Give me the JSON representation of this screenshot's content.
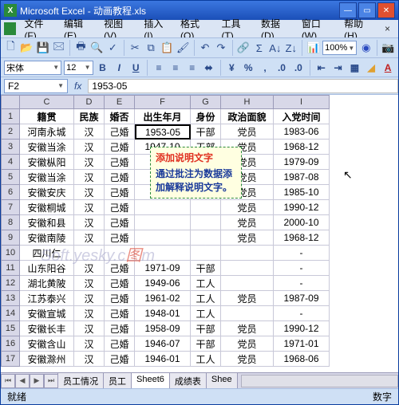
{
  "window": {
    "app": "Microsoft Excel",
    "doc": "动画教程.xls"
  },
  "menu": [
    "文件(F)",
    "编辑(E)",
    "视图(V)",
    "插入(I)",
    "格式(O)",
    "工具(T)",
    "数据(D)",
    "窗口(W)",
    "帮助(H)"
  ],
  "zoom": "100%",
  "font": {
    "name": "宋体",
    "size": "12"
  },
  "namebox": "F2",
  "formula": "1953-05",
  "colHeaders": [
    "C",
    "D",
    "E",
    "F",
    "G",
    "H",
    "I"
  ],
  "dataHeaders": [
    "籍贯",
    "民族",
    "婚否",
    "出生年月",
    "身份",
    "政治面貌",
    "入党时间"
  ],
  "rows": [
    {
      "n": 2,
      "c": "河南永城",
      "d": "汉",
      "e": "己婚",
      "f": "1953-05",
      "g": "干部",
      "h": "党员",
      "i": "1983-06"
    },
    {
      "n": 3,
      "c": "安徽当涂",
      "d": "汉",
      "e": "己婚",
      "f": "1947-10",
      "g": "干部",
      "h": "党员",
      "i": "1968-12"
    },
    {
      "n": 4,
      "c": "安徽枞阳",
      "d": "汉",
      "e": "己婚",
      "f": "",
      "g": "",
      "h": "党员",
      "i": "1979-09"
    },
    {
      "n": 5,
      "c": "安徽当涂",
      "d": "汉",
      "e": "己婚",
      "f": "",
      "g": "",
      "h": "党员",
      "i": "1987-08"
    },
    {
      "n": 6,
      "c": "安徽安庆",
      "d": "汉",
      "e": "己婚",
      "f": "",
      "g": "",
      "h": "党员",
      "i": "1985-10"
    },
    {
      "n": 7,
      "c": "安徽桐城",
      "d": "汉",
      "e": "己婚",
      "f": "",
      "g": "",
      "h": "党员",
      "i": "1990-12"
    },
    {
      "n": 8,
      "c": "安徽和县",
      "d": "汉",
      "e": "己婚",
      "f": "",
      "g": "",
      "h": "党员",
      "i": "2000-10"
    },
    {
      "n": 9,
      "c": "安徽南陵",
      "d": "汉",
      "e": "己婚",
      "f": "",
      "g": "",
      "h": "党员",
      "i": "1968-12"
    },
    {
      "n": 10,
      "c": "四川仁",
      "d": "",
      "e": "",
      "f": "",
      "g": "",
      "h": "",
      "i": "-"
    },
    {
      "n": 11,
      "c": "山东阳谷",
      "d": "汉",
      "e": "己婚",
      "f": "1971-09",
      "g": "干部",
      "h": "",
      "i": "-"
    },
    {
      "n": 12,
      "c": "湖北黄陂",
      "d": "汉",
      "e": "己婚",
      "f": "1949-06",
      "g": "工人",
      "h": "",
      "i": "-"
    },
    {
      "n": 13,
      "c": "江苏泰兴",
      "d": "汉",
      "e": "己婚",
      "f": "1961-02",
      "g": "工人",
      "h": "党员",
      "i": "1987-09"
    },
    {
      "n": 14,
      "c": "安徽宣城",
      "d": "汉",
      "e": "己婚",
      "f": "1948-01",
      "g": "工人",
      "h": "",
      "i": "-"
    },
    {
      "n": 15,
      "c": "安徽长丰",
      "d": "汉",
      "e": "己婚",
      "f": "1958-09",
      "g": "干部",
      "h": "党员",
      "i": "1990-12"
    },
    {
      "n": 16,
      "c": "安徽含山",
      "d": "汉",
      "e": "己婚",
      "f": "1946-07",
      "g": "干部",
      "h": "党员",
      "i": "1971-01"
    },
    {
      "n": 17,
      "c": "安徽滁州",
      "d": "汉",
      "e": "己婚",
      "f": "1946-01",
      "g": "工人",
      "h": "党员",
      "i": "1968-06"
    }
  ],
  "tooltip": {
    "title": "添加说明文字",
    "body": "通过批注为数据添加解释说明文字。"
  },
  "watermark": {
    "t1": "Soft.yesky.c",
    "t2": "图",
    "t3": "m"
  },
  "sheets": [
    "员工情况",
    "员工",
    "Sheet6",
    "成绩表",
    "Shee"
  ],
  "status": {
    "left": "就绪",
    "right": "数字"
  }
}
